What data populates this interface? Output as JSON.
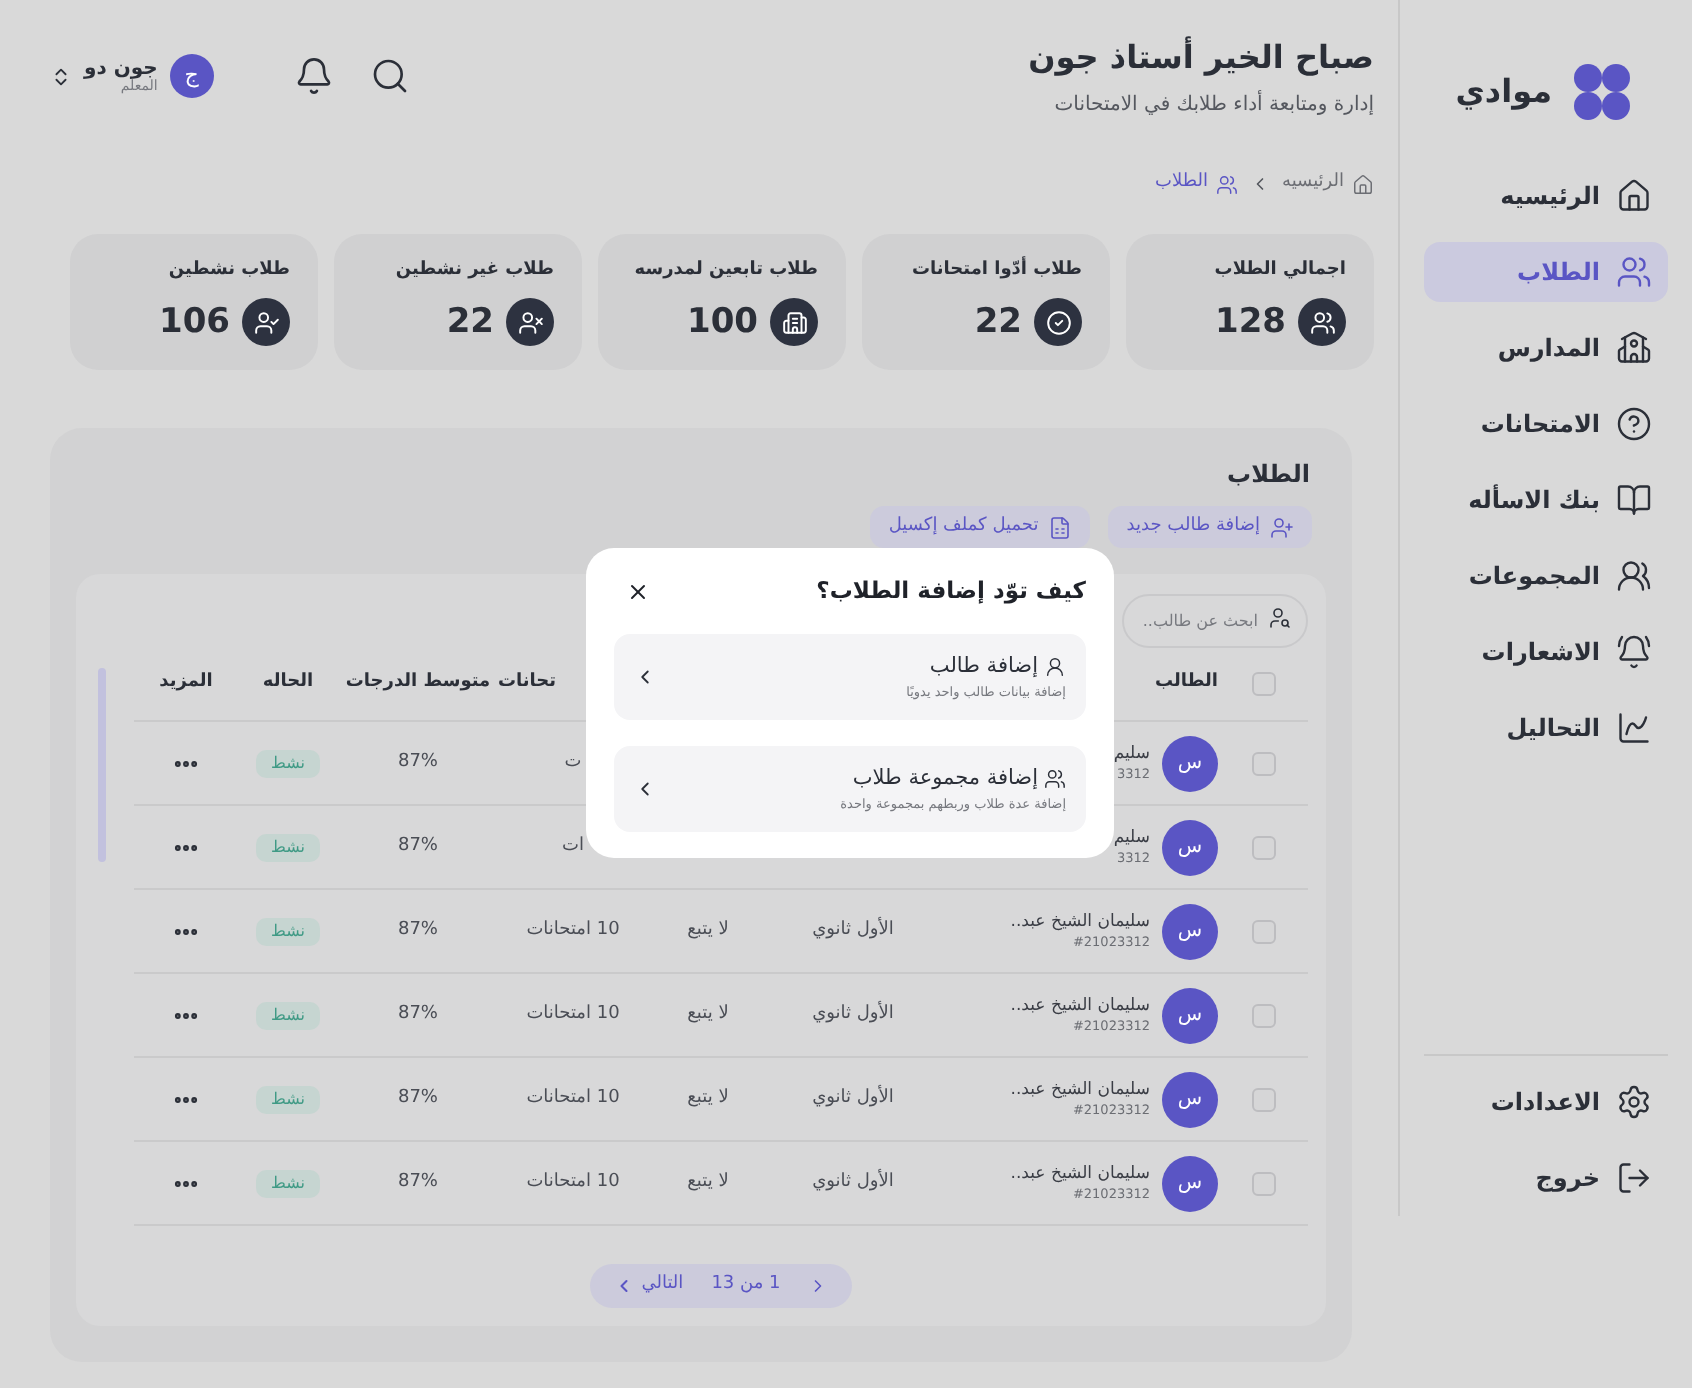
{
  "sidebar": {
    "brand": "موادي",
    "items": [
      {
        "label": "الرئيسيه",
        "selected": false
      },
      {
        "label": "الطلاب",
        "selected": true
      },
      {
        "label": "المدارس",
        "selected": false
      },
      {
        "label": "الامتحانات",
        "selected": false
      },
      {
        "label": "بنك الاسأله",
        "selected": false
      },
      {
        "label": "المجموعات",
        "selected": false
      },
      {
        "label": "الاشعارات",
        "selected": false
      },
      {
        "label": "التحاليل",
        "selected": false
      }
    ],
    "footer_items": [
      {
        "label": "الاعدادات"
      },
      {
        "label": "خروج"
      }
    ]
  },
  "header": {
    "greeting": "صباح الخير أستاذ جون",
    "subtitle": "إدارة ومتابعة أداء طلابك في الامتحانات"
  },
  "user": {
    "initial": "ج",
    "name": "جون دو",
    "role": "المعلم"
  },
  "breadcrumb": [
    {
      "label": "الرئيسيه",
      "current": false
    },
    {
      "label": "الطلاب",
      "current": true
    }
  ],
  "stats": [
    {
      "label": "اجمالي الطلاب",
      "value": "128"
    },
    {
      "label": "طلاب أدّوا امتحانات",
      "value": "22"
    },
    {
      "label": "طلاب تابعين لمدرسه",
      "value": "100"
    },
    {
      "label": "طلاب غير نشطين",
      "value": "22"
    },
    {
      "label": "طلاب نشطين",
      "value": "106"
    }
  ],
  "students_panel": {
    "title": "الطلاب",
    "buttons": [
      "إضافة طالب جديد",
      "تحميل كملف إكسيل"
    ],
    "search": {
      "placeholder": "ابحث عن طالب.."
    },
    "select_all": {
      "checked": false
    },
    "columns": [
      "الطالب",
      "تحانات",
      "متوسط الدرجات",
      "الحاله",
      "المزيد"
    ],
    "rows": [
      {
        "checked": false,
        "avatar": "س",
        "name": "سليم",
        "student_id": "3312",
        "exams": "ت",
        "average": "87%",
        "status": "نشط"
      },
      {
        "checked": false,
        "avatar": "س",
        "name": "سليم",
        "student_id": "3312",
        "exams": "ات",
        "average": "87%",
        "status": "نشط"
      },
      {
        "checked": false,
        "avatar": "س",
        "name": "سليمان الشيخ عبد..",
        "student_id": "#21023312",
        "grade": "الأول ثانوي",
        "follows": "لا يتبع",
        "exams": "10 امتحانات",
        "average": "87%",
        "status": "نشط"
      },
      {
        "checked": false,
        "avatar": "س",
        "name": "سليمان الشيخ عبد..",
        "student_id": "#21023312",
        "grade": "الأول ثانوي",
        "follows": "لا يتبع",
        "exams": "10 امتحانات",
        "average": "87%",
        "status": "نشط"
      },
      {
        "checked": false,
        "avatar": "س",
        "name": "سليمان الشيخ عبد..",
        "student_id": "#21023312",
        "grade": "الأول ثانوي",
        "follows": "لا يتبع",
        "exams": "10 امتحانات",
        "average": "87%",
        "status": "نشط"
      },
      {
        "checked": false,
        "avatar": "س",
        "name": "سليمان الشيخ عبد..",
        "student_id": "#21023312",
        "grade": "الأول ثانوي",
        "follows": "لا يتبع",
        "exams": "10 امتحانات",
        "average": "87%",
        "status": "نشط"
      }
    ],
    "pagination": {
      "page": "1 من 13",
      "next": "التالي"
    }
  },
  "modal": {
    "title": "كيف توّد إضافة الطلاب؟",
    "options": [
      {
        "title": "إضافة طالب",
        "subtitle": "إضافة بيانات طالب واحد يدويًا"
      },
      {
        "title": "إضافة مجموعة طلاب",
        "subtitle": "إضافة عدة طلاب وربطهم بمجموعة واحدة"
      }
    ]
  }
}
